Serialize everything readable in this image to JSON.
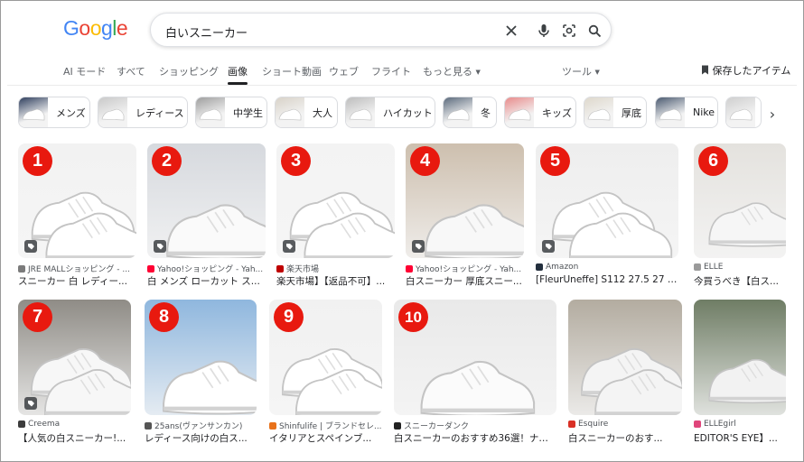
{
  "logo": {
    "letters": [
      "G",
      "o",
      "o",
      "g",
      "l",
      "e"
    ],
    "colors": [
      "#4285F4",
      "#EA4335",
      "#FBBC05",
      "#4285F4",
      "#34A853",
      "#EA4335"
    ]
  },
  "search": {
    "query": "白いスニーカー",
    "clear_icon": "close-icon",
    "voice_icon": "mic-icon",
    "lens_icon": "lens-icon",
    "search_icon": "search-icon"
  },
  "nav": {
    "items": [
      "AI モード",
      "すべて",
      "ショッピング",
      "画像",
      "ショート動画",
      "ウェブ",
      "フライト",
      "もっと見る"
    ],
    "active": "画像",
    "tools": "ツール",
    "saved": "保存したアイテム"
  },
  "chips": [
    {
      "label": "メンズ",
      "color": "#2f3f5e"
    },
    {
      "label": "レディース",
      "color": "#c9c9c9"
    },
    {
      "label": "中学生",
      "color": "#9e9e9e"
    },
    {
      "label": "大人",
      "color": "#d8d2c8"
    },
    {
      "label": "ハイカット",
      "color": "#bdbdbd"
    },
    {
      "label": "冬",
      "color": "#5b6a7c"
    },
    {
      "label": "キッズ",
      "color": "#e88b8b"
    },
    {
      "label": "厚底",
      "color": "#ded8cc"
    },
    {
      "label": "Nike",
      "color": "#4a5a70"
    },
    {
      "label": "",
      "color": "#cfcfcf"
    }
  ],
  "results_row1": [
    {
      "num": "1",
      "source": "JRE MALLショッピング - ...",
      "title": "スニーカー 白 レディー...",
      "bg": "#f2f2f2",
      "shoe": "#ffffff",
      "fav": "#7b7b7b"
    },
    {
      "num": "2",
      "source": "Yahoo!ショッピング - Yah...",
      "title": "白 メンズ ローカット ス...",
      "bg": "#d6d9de",
      "shoe": "#fafafa",
      "fav": "#ff0033"
    },
    {
      "num": "3",
      "source": "楽天市場",
      "title": "楽天市場】【返品不可】...",
      "bg": "#f3f3f3",
      "shoe": "#ffffff",
      "fav": "#bf0000"
    },
    {
      "num": "4",
      "source": "Yahoo!ショッピング - Yah...",
      "title": "白スニーカー 厚底スニー...",
      "bg": "#cdbfae",
      "shoe": "#f8f8f8",
      "fav": "#ff0033"
    },
    {
      "num": "5",
      "source": "Amazon",
      "title": "[FleurUneffe] S112 27.5 27 26.5...",
      "bg": "#eeeeee",
      "shoe": "#ffffff",
      "fav": "#232f3e"
    },
    {
      "num": "6",
      "source": "ELLE",
      "title": "今買うべき【白ス...",
      "bg": "#e4e2de",
      "shoe": "#f6f6f6",
      "fav": "#9a9a9a"
    }
  ],
  "results_row2": [
    {
      "num": "7",
      "source": "Creema",
      "title": "【人気の白スニーカー!...",
      "bg": "#8f8c86",
      "shoe": "#f7f7f7",
      "fav": "#3c3c3c"
    },
    {
      "num": "8",
      "source": "25ans(ヴァンサンカン)",
      "title": "レディース向けの白ス...",
      "bg": "#8fb7de",
      "shoe": "#ffffff",
      "fav": "#555555"
    },
    {
      "num": "9",
      "source": "Shinfulife | ブランドセレ...",
      "title": "イタリアとスペインブ...",
      "bg": "#f1f1f1",
      "shoe": "#ffffff",
      "fav": "#e8711a"
    },
    {
      "num": "10",
      "source": "スニーカーダンク",
      "title": "白スニーカーのおすすめ36選！ナイ...",
      "bg": "#e9e9e9",
      "shoe": "#fbfbfb",
      "fav": "#222222"
    },
    {
      "num": "",
      "source": "Esquire",
      "title": "白スニーカーのおす...",
      "bg": "#b3aca0",
      "shoe": "#f4f4f4",
      "fav": "#d93025"
    },
    {
      "num": "",
      "source": "ELLEgirl",
      "title": "EDITOR'S EYE】...",
      "bg": "#6f7d65",
      "shoe": "#f2f2f2",
      "fav": "#e0457b"
    }
  ]
}
